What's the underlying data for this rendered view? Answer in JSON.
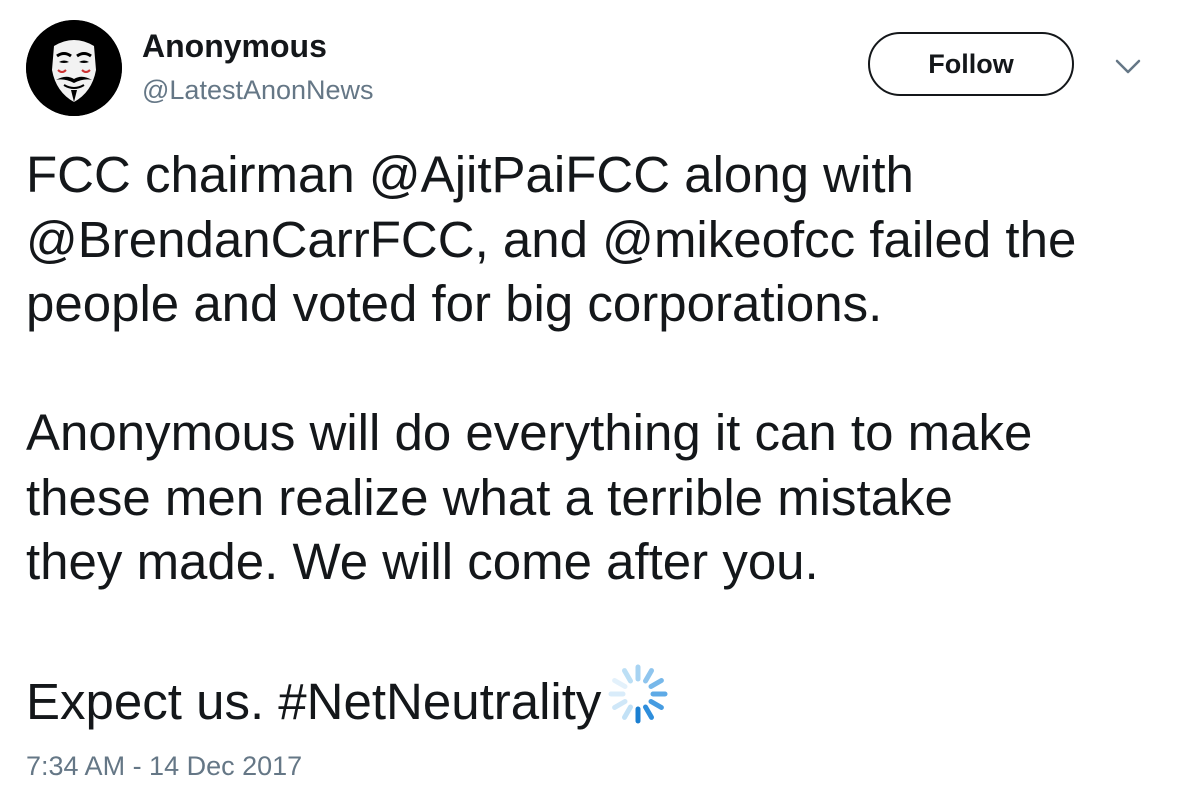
{
  "user": {
    "display_name": "Anonymous",
    "handle": "@LatestAnonNews",
    "avatar_icon": "guy-fawkes-mask-icon"
  },
  "actions": {
    "follow_label": "Follow",
    "menu_icon": "chevron-down-icon"
  },
  "tweet": {
    "lines": [
      "FCC chairman @AjitPaiFCC along with",
      "@BrendanCarrFCC, and @mikeofcc failed the",
      "people and voted for big corporations.",
      "Anonymous will do everything it can to make",
      "these men realize what a terrible mistake",
      "they made. We will come after you.",
      "Expect us. #NetNeutrality"
    ],
    "hashtag_emoji_icon": "loading-spinner-icon",
    "timestamp": "7:34 AM - 14 Dec 2017"
  },
  "colors": {
    "text": "#14171a",
    "secondary": "#657786",
    "spinner_light": "#a7d3f2",
    "spinner_dark": "#1b7fd1"
  }
}
